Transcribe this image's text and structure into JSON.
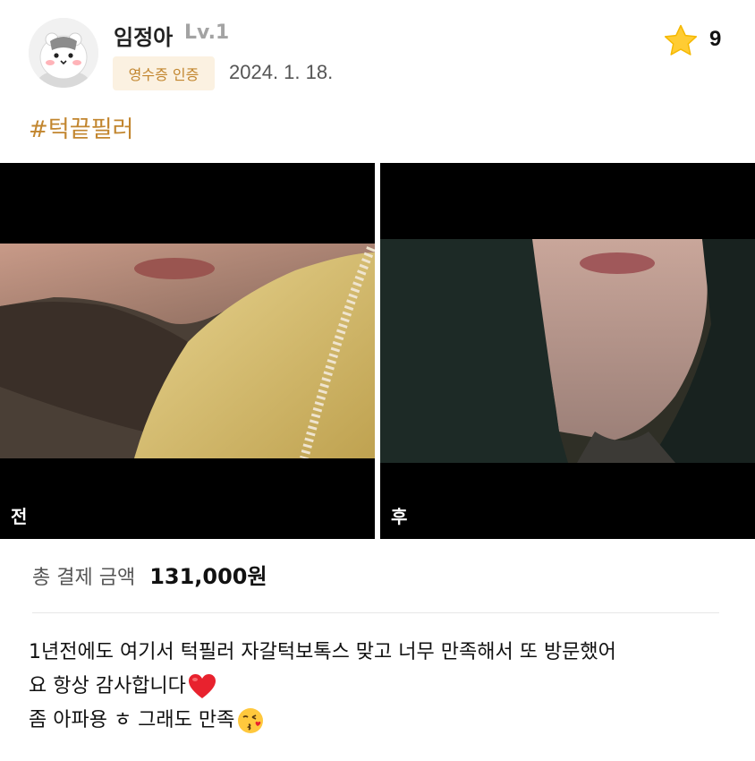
{
  "user": {
    "name": "임정아",
    "level": "Lv.1",
    "badge": "영수증 인증",
    "date": "2024. 1. 18."
  },
  "rating": {
    "icon": "star-icon",
    "count": "9"
  },
  "hashtag": "#턱끝필러",
  "photos": [
    {
      "label": "전",
      "name": "before-photo"
    },
    {
      "label": "후",
      "name": "after-photo"
    }
  ],
  "payment": {
    "label": "총 결제 금액",
    "amount": "131,000원"
  },
  "review": {
    "line1": "1년전에도 여기서 턱필러 자갈턱보톡스 맞고 너무 만족해서 또 방문했어",
    "line2": "요 항상 감사합니다",
    "line3": "좀 아파용 ㅎ 그래도 만족"
  },
  "colors": {
    "accent": "#c2862f",
    "badge_bg": "#fbf1e1",
    "star": "#ffcc33",
    "heart": "#e8222e"
  }
}
